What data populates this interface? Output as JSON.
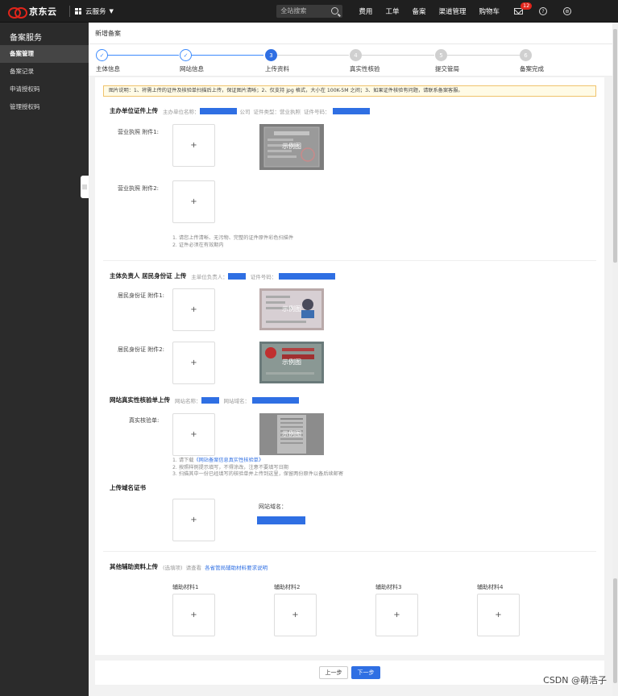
{
  "topbar": {
    "logo_text": "京东云",
    "cloud_service": "云服务",
    "search_placeholder": "全站搜索",
    "links": [
      "费用",
      "工单",
      "备案",
      "渠道管理",
      "购物车"
    ],
    "mail_badge": "12",
    "help_icon": "?",
    "user_icon": "⊕"
  },
  "sidebar": {
    "title": "备案服务",
    "items": [
      {
        "label": "备案管理",
        "active": true
      },
      {
        "label": "备案记录",
        "active": false
      },
      {
        "label": "申请授权码",
        "active": false
      },
      {
        "label": "管理授权码",
        "active": false
      }
    ],
    "collapse_glyph": "|||"
  },
  "page": {
    "title": "新增备案"
  },
  "steps": [
    {
      "num": "✓",
      "label": "主体信息",
      "state": "done"
    },
    {
      "num": "✓",
      "label": "网站信息",
      "state": "done"
    },
    {
      "num": "3",
      "label": "上传资料",
      "state": "cur"
    },
    {
      "num": "4",
      "label": "真实性核验",
      "state": "todo"
    },
    {
      "num": "5",
      "label": "提交管局",
      "state": "todo"
    },
    {
      "num": "6",
      "label": "备案完成",
      "state": "todo"
    }
  ],
  "notice": "图片说明：1、将需上传的证件及核验单扫描后上传，保证图片清晰；2、仅支持 jpg 格式，大小在 100K-5M 之间；3、如果证件核验有问题，请联系备案客服。",
  "sections": {
    "org": {
      "title": "主办单位证件上传",
      "sub": "主办单位名称：",
      "sub_suffix": "公司",
      "sub_type": "证件类型：营业执照",
      "sub_no": "证件号码：",
      "label1": "营业执照 附件1:",
      "label2": "营业执照 附件2:",
      "sample": "示例图",
      "hint1": "1. 请您上传清晰、无污物、完整的证件原件彩色扫描件",
      "hint2": "2. 证件必须在有效期内"
    },
    "person": {
      "title": "主体负责人 居民身份证 上传",
      "sub": "主单位负责人：",
      "sub_no": "证件号码：",
      "label1": "居民身份证 附件1:",
      "label2": "居民身份证 附件2:",
      "sample": "示例图"
    },
    "verify": {
      "title": "网站真实性核验单上传",
      "sub": "网站名称：",
      "sub2": "网站域名：",
      "label": "真实核验单:",
      "sample": "示例图",
      "hint1_pre": "1. 请下载",
      "hint1_link": "《网站备案信息真实性核验单》",
      "hint2": "2. 按照样例提示填写，不得涂改，注意不要填写日期",
      "hint3": "3. 扫描其中一份已经填写的核验单并上传到这里，保留两份原件以备后续邮寄"
    },
    "domain": {
      "title": "上传域名证书",
      "label": "网站域名："
    },
    "aux": {
      "title": "其他辅助资料上传",
      "optional": "(选填项)",
      "see": "请查看",
      "link": "各省管局辅助材料要求说明",
      "items": [
        "辅助材料1",
        "辅助材料2",
        "辅助材料3",
        "辅助材料4"
      ]
    }
  },
  "upload_glyph": "+",
  "buttons": {
    "prev": "上一步",
    "next": "下一步"
  },
  "watermark": "CSDN @萌浩子",
  "colors": {
    "accent": "#2f6fe3",
    "brand_red": "#e1251b",
    "notice_border": "#f0c36d"
  }
}
